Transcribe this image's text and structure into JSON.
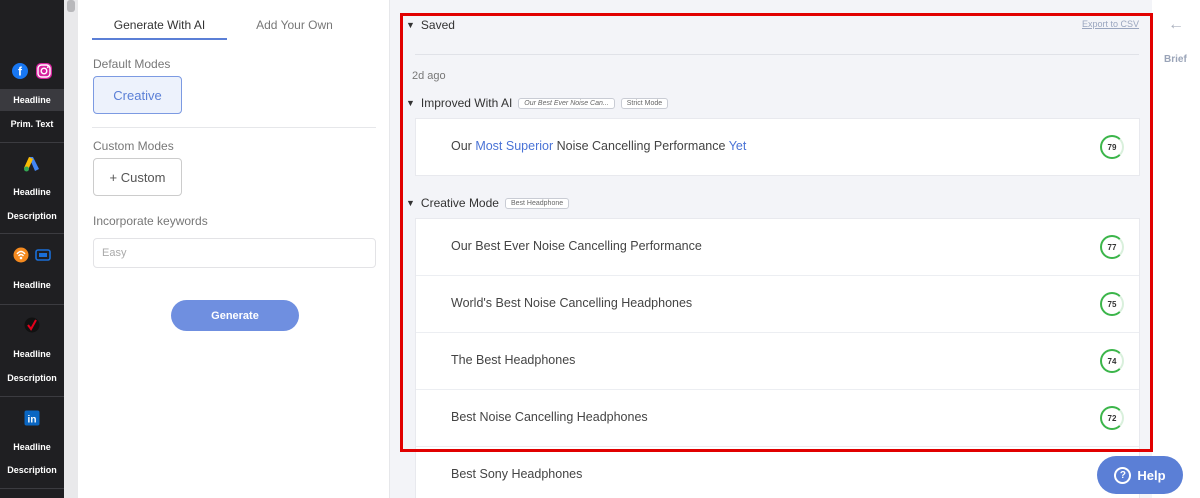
{
  "sidebar": {
    "groups": [
      {
        "icons": [
          "facebook-icon",
          "instagram-icon"
        ],
        "items": [
          "Headline",
          "Prim. Text"
        ],
        "active": 0
      },
      {
        "icons": [
          "google-ads-icon"
        ],
        "items": [
          "Headline",
          "Description"
        ]
      },
      {
        "icons": [
          "podcast-icon",
          "tv-icon"
        ],
        "items": [
          "Headline"
        ]
      },
      {
        "icons": [
          "verizon-check-icon"
        ],
        "items": [
          "Headline",
          "Description"
        ]
      },
      {
        "icons": [
          "linkedin-icon"
        ],
        "items": [
          "Headline",
          "Description"
        ]
      }
    ]
  },
  "panel": {
    "tabs": [
      "Generate With AI",
      "Add Your Own"
    ],
    "default_modes_label": "Default Modes",
    "creative_button": "Creative",
    "custom_modes_label": "Custom Modes",
    "custom_button": "+ Custom",
    "keywords_label": "Incorporate keywords",
    "keywords_placeholder": "Easy",
    "generate_button": "Generate"
  },
  "main": {
    "saved_title": "Saved",
    "export_link": "Export to CSV",
    "timestamp": "2d ago",
    "improved": {
      "title": "Improved With AI",
      "tags": [
        "Our Best Ever Noise Can...",
        "Strict Mode"
      ],
      "result": {
        "parts": [
          "Our ",
          "Most Superior",
          " Noise Cancelling Performance ",
          "Yet"
        ],
        "score": "79"
      }
    },
    "creative": {
      "title": "Creative Mode",
      "tag": "Best Headphone",
      "results": [
        {
          "text": "Our Best Ever Noise Cancelling Performance",
          "score": "77"
        },
        {
          "text": "World's Best Noise Cancelling Headphones",
          "score": "75"
        },
        {
          "text": "The Best Headphones",
          "score": "74"
        },
        {
          "text": "Best Noise Cancelling Headphones",
          "score": "72"
        },
        {
          "text": "Best Sony Headphones",
          "score": ""
        }
      ]
    }
  },
  "rightbar": {
    "brief_label": "Brief"
  },
  "help_button": "Help"
}
